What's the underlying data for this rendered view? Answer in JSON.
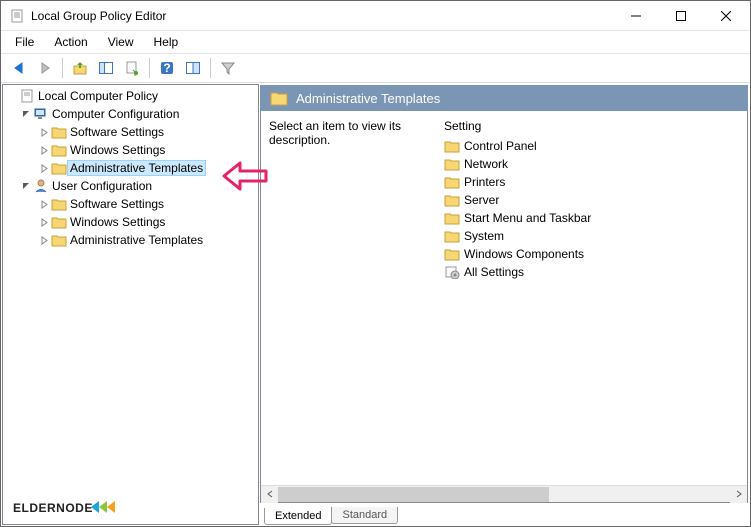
{
  "window": {
    "title": "Local Group Policy Editor"
  },
  "menu": {
    "file": "File",
    "action": "Action",
    "view": "View",
    "help": "Help"
  },
  "tree": {
    "root": "Local Computer Policy",
    "comp": "Computer Configuration",
    "comp_sw": "Software Settings",
    "comp_win": "Windows Settings",
    "comp_adm": "Administrative Templates",
    "user": "User Configuration",
    "user_sw": "Software Settings",
    "user_win": "Windows Settings",
    "user_adm": "Administrative Templates"
  },
  "header": {
    "title": "Administrative Templates"
  },
  "description": "Select an item to view its description.",
  "settings": {
    "header": "Setting",
    "items": {
      "0": "Control Panel",
      "1": "Network",
      "2": "Printers",
      "3": "Server",
      "4": "Start Menu and Taskbar",
      "5": "System",
      "6": "Windows Components",
      "7": "All Settings"
    }
  },
  "tabs": {
    "extended": "Extended",
    "standard": "Standard"
  },
  "logo": "ELDERNODE"
}
